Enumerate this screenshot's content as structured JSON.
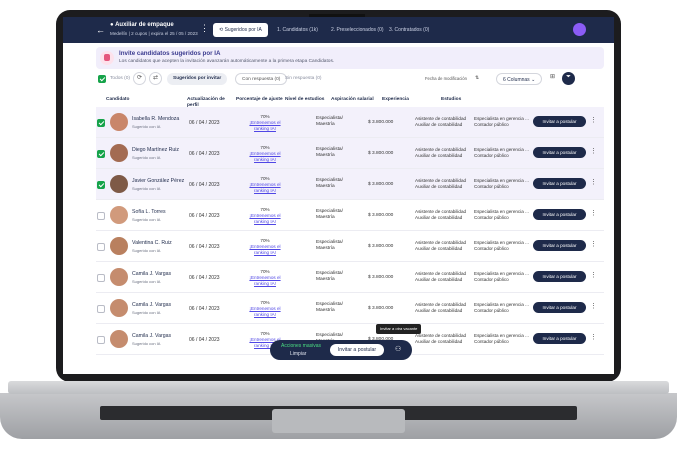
{
  "nav": {
    "back": "←",
    "job_title": "● Auxiliar de empaque",
    "job_sub": "Medellín | 2 cupos | expira el 25 / 05 / 2023",
    "menu": "⋮",
    "tabs": [
      {
        "label": "⟲ Sugeridos por IA"
      },
      {
        "label": "1. Candidatos (1k)"
      },
      {
        "label": "2. Preseleccionados (0)"
      },
      {
        "label": "3. Contratados (0)"
      }
    ]
  },
  "banner": {
    "title": "Invite candidatos sugeridos por IA",
    "desc": "Los candidatos que acepten la invitación avanzarán automáticamente a la primera etapa Candidatos."
  },
  "toolbar": {
    "all_label": "Todos (0)",
    "suggested_label": "Sugeridos por invitar",
    "with_answer_label": "Con respuesta (0)",
    "without_answer_label": "Sin respuesta (0)",
    "sort_label": "Fecha de modificación",
    "columns_label": "6 Columnas"
  },
  "table": {
    "headers": [
      "Candidato",
      "Actualización de perfil",
      "Porcentaje de ajuste",
      "Nivel de estudios",
      "Aspiración salarial",
      "Experiencia",
      "Estudios"
    ],
    "rows": [
      {
        "name": "Isabella R. Mendoza",
        "source": "Sugerido con IA",
        "date": "06 / 04 / 2023",
        "pct": "70%",
        "pct_link": "¡Entrenemos el ranking IA!",
        "level": "Especialista/ Maestría",
        "salary": "$ 3.800.000",
        "exp": "Asistente de contabilidad Auxiliar de contabilidad",
        "studies": "Especialista en gerencia ... Contador público",
        "invite": "Invitar a postular",
        "checked": true,
        "color": "#c9866a"
      },
      {
        "name": "Diego Martínez Ruiz",
        "source": "Sugerido con IA",
        "date": "06 / 04 / 2023",
        "pct": "70%",
        "pct_link": "¡Entrenemos el ranking IA!",
        "level": "Especialista/ Maestría",
        "salary": "$ 3.800.000",
        "exp": "Asistente de contabilidad Auxiliar de contabilidad",
        "studies": "Especialista en gerencia ... Contador público",
        "invite": "Invitar a postular",
        "checked": true,
        "color": "#a36b52"
      },
      {
        "name": "Javier González Pérez",
        "source": "Sugerido con IA",
        "date": "06 / 04 / 2023",
        "pct": "70%",
        "pct_link": "¡Entrenemos el ranking IA!",
        "level": "Especialista/ Maestría",
        "salary": "$ 3.800.000",
        "exp": "Asistente de contabilidad Auxiliar de contabilidad",
        "studies": "Especialista en gerencia ... Contador público",
        "invite": "Invitar a postular",
        "checked": true,
        "color": "#7e5a47"
      },
      {
        "name": "Sofía L. Torres",
        "source": "Sugerido con IA",
        "date": "06 / 04 / 2023",
        "pct": "70%",
        "pct_link": "¡Entrenemos el ranking IA!",
        "level": "Especialista/ Maestría",
        "salary": "$ 3.800.000",
        "exp": "Asistente de contabilidad Auxiliar de contabilidad",
        "studies": "Especialista en gerencia ... Contador público",
        "invite": "Invitar a postular",
        "checked": false,
        "color": "#d19a7c"
      },
      {
        "name": "Valentina C. Ruiz",
        "source": "Sugerido con IA",
        "date": "06 / 04 / 2023",
        "pct": "70%",
        "pct_link": "¡Entrenemos el ranking IA!",
        "level": "Especialista/ Maestría",
        "salary": "$ 3.800.000",
        "exp": "Asistente de contabilidad Auxiliar de contabilidad",
        "studies": "Especialista en gerencia ... Contador público",
        "invite": "Invitar a postular",
        "checked": false,
        "color": "#b9805f"
      },
      {
        "name": "Camila J. Vargas",
        "source": "Sugerido con IA",
        "date": "06 / 04 / 2023",
        "pct": "70%",
        "pct_link": "¡Entrenemos el ranking IA!",
        "level": "Especialista/ Maestría",
        "salary": "$ 3.800.000",
        "exp": "Asistente de contabilidad Auxiliar de contabilidad",
        "studies": "Especialista en gerencia ... Contador público",
        "invite": "Invitar a postular",
        "checked": false,
        "color": "#c58c6e"
      },
      {
        "name": "Camila J. Vargas",
        "source": "Sugerido con IA",
        "date": "06 / 04 / 2023",
        "pct": "70%",
        "pct_link": "¡Entrenemos el ranking IA!",
        "level": "Especialista/ Maestría",
        "salary": "$ 3.800.000",
        "exp": "Asistente de contabilidad Auxiliar de contabilidad",
        "studies": "Especialista en gerencia ... Contador público",
        "invite": "Invitar a postular",
        "checked": false,
        "color": "#c58c6e"
      },
      {
        "name": "Camila J. Vargas",
        "source": "Sugerido con IA",
        "date": "06 / 04 / 2023",
        "pct": "70%",
        "pct_link": "¡Entrenemos el ranking IA!",
        "level": "Especialista/ Maestría",
        "salary": "$ 3.800.000",
        "exp": "Asistente de contabilidad Auxiliar de contabilidad",
        "studies": "Especialista en gerencia ... Contador público",
        "invite": "Invitar a postular",
        "checked": false,
        "color": "#c58c6e"
      }
    ]
  },
  "mass": {
    "title": "Acciones masivas",
    "clear": "Limpiar",
    "invite": "Invitar a postular",
    "tooltip": "Invitar a otra vacante"
  }
}
